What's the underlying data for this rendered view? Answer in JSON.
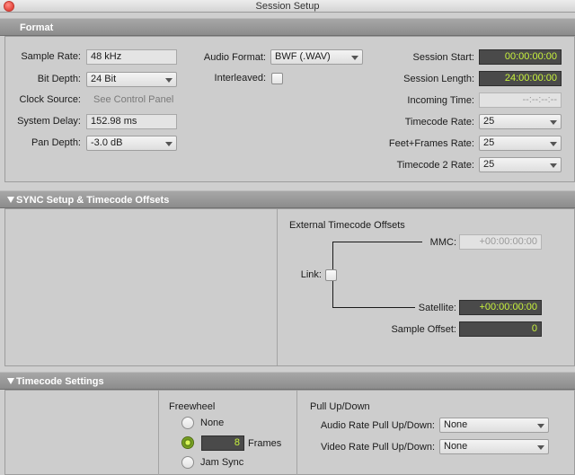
{
  "window": {
    "title": "Session Setup"
  },
  "format": {
    "header": "Format",
    "sample_rate": {
      "label": "Sample Rate:",
      "value": "48 kHz"
    },
    "bit_depth": {
      "label": "Bit Depth:",
      "value": "24 Bit"
    },
    "clock_source": {
      "label": "Clock Source:",
      "value": "See Control Panel"
    },
    "system_delay": {
      "label": "System Delay:",
      "value": "152.98 ms"
    },
    "pan_depth": {
      "label": "Pan Depth:",
      "value": "-3.0 dB"
    },
    "audio_format": {
      "label": "Audio Format:",
      "value": "BWF (.WAV)"
    },
    "interleaved": {
      "label": "Interleaved:",
      "checked": false
    },
    "session_start": {
      "label": "Session Start:",
      "value": "00:00:00:00"
    },
    "session_length": {
      "label": "Session Length:",
      "value": "24:00:00:00"
    },
    "incoming_time": {
      "label": "Incoming Time:",
      "value": "--:--:--:--"
    },
    "timecode_rate": {
      "label": "Timecode Rate:",
      "value": "25"
    },
    "feet_frames_rate": {
      "label": "Feet+Frames Rate:",
      "value": "25"
    },
    "timecode2_rate": {
      "label": "Timecode 2 Rate:",
      "value": "25"
    }
  },
  "sync": {
    "header": "SYNC Setup & Timecode Offsets",
    "offsets_title": "External Timecode Offsets",
    "mmc": {
      "label": "MMC:",
      "value": "+00:00:00:00"
    },
    "link": {
      "label": "Link:",
      "checked": false
    },
    "satellite": {
      "label": "Satellite:",
      "value": "+00:00:00:00"
    },
    "sample_offset": {
      "label": "Sample Offset:",
      "value": "0"
    }
  },
  "timecode": {
    "header": "Timecode Settings",
    "freewheel": {
      "title": "Freewheel",
      "none_label": "None",
      "frames_value": "8",
      "frames_label": "Frames",
      "jam_sync_label": "Jam Sync",
      "selected": "frames"
    },
    "pullup": {
      "title": "Pull Up/Down",
      "audio_label": "Audio Rate Pull Up/Down:",
      "audio_value": "None",
      "video_label": "Video Rate Pull Up/Down:",
      "video_value": "None"
    }
  },
  "colors": {
    "timecode_text": "#c8f23c",
    "timecode_bg": "#4a4a4a",
    "header_bg": "#9a9a9a"
  }
}
